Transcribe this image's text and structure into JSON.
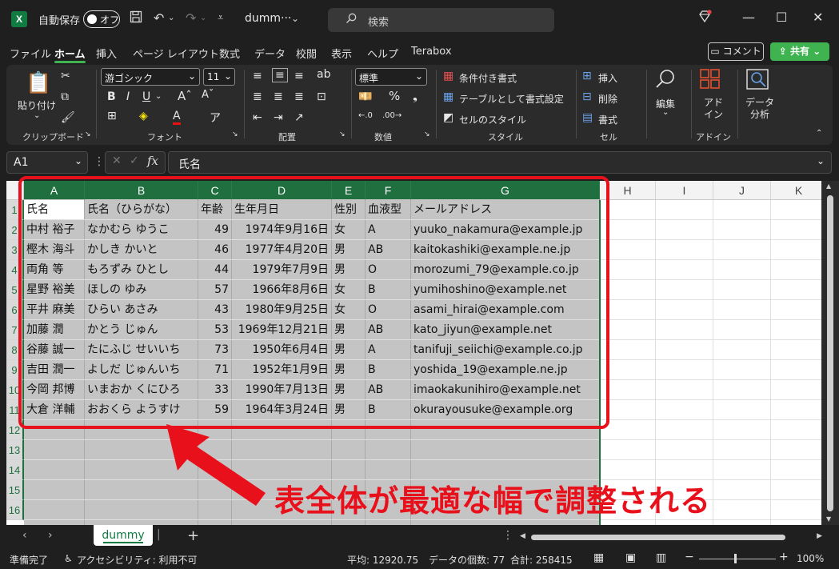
{
  "titlebar": {
    "autosave_label": "自動保存",
    "autosave_state": "オフ",
    "file_name": "dumm···",
    "search_placeholder": "検索"
  },
  "menu": {
    "tabs": [
      "ファイル",
      "ホーム",
      "挿入",
      "ページ レイアウト",
      "数式",
      "データ",
      "校閲",
      "表示",
      "ヘルプ",
      "Terabox"
    ],
    "active_tab": "ホーム",
    "comment_label": "コメント",
    "share_label": "共有"
  },
  "ribbon": {
    "clipboard": {
      "paste_label": "貼り付け",
      "group_label": "クリップボード"
    },
    "font": {
      "font_name": "游ゴシック",
      "font_size": "11",
      "group_label": "フォント"
    },
    "alignment": {
      "group_label": "配置"
    },
    "number": {
      "format": "標準",
      "group_label": "数値"
    },
    "styles": {
      "conditional_label": "条件付き書式",
      "table_label": "テーブルとして書式設定",
      "cell_style_label": "セルのスタイル",
      "group_label": "スタイル"
    },
    "cells": {
      "insert_label": "挿入",
      "delete_label": "削除",
      "format_label": "書式",
      "group_label": "セル"
    },
    "editing": {
      "label": "編集"
    },
    "addins": {
      "label": "アド\nイン",
      "group_label": "アドイン"
    },
    "analysis": {
      "label": "データ\n分析"
    }
  },
  "formula_bar": {
    "name_box": "A1",
    "formula": "氏名"
  },
  "columns": [
    "A",
    "B",
    "C",
    "D",
    "E",
    "F",
    "G",
    "H",
    "I",
    "J",
    "K"
  ],
  "rows": [
    "1",
    "2",
    "3",
    "4",
    "5",
    "6",
    "7",
    "8",
    "9",
    "10",
    "11",
    "12",
    "13",
    "14",
    "15",
    "16"
  ],
  "table": {
    "header": [
      "氏名",
      "氏名（ひらがな）",
      "年齢",
      "生年月日",
      "性別",
      "血液型",
      "メールアドレス"
    ],
    "rows": [
      [
        "中村 裕子",
        "なかむら ゆうこ",
        "49",
        "1974年9月16日",
        "女",
        "A",
        "yuuko_nakamura@example.jp"
      ],
      [
        "樫木 海斗",
        "かしき かいと",
        "46",
        "1977年4月20日",
        "男",
        "AB",
        "kaitokashiki@example.ne.jp"
      ],
      [
        "両角 等",
        "もろずみ ひとし",
        "44",
        "1979年7月9日",
        "男",
        "O",
        "morozumi_79@example.co.jp"
      ],
      [
        "星野 裕美",
        "ほしの ゆみ",
        "57",
        "1966年8月6日",
        "女",
        "B",
        "yumihoshino@example.net"
      ],
      [
        "平井 麻美",
        "ひらい あさみ",
        "43",
        "1980年9月25日",
        "女",
        "O",
        "asami_hirai@example.com"
      ],
      [
        "加藤 潤",
        "かとう じゅん",
        "53",
        "1969年12月21日",
        "男",
        "AB",
        "kato_jiyun@example.net"
      ],
      [
        "谷藤 誠一",
        "たにふじ せいいち",
        "73",
        "1950年6月4日",
        "男",
        "A",
        "tanifuji_seiichi@example.co.jp"
      ],
      [
        "吉田 潤一",
        "よしだ じゅんいち",
        "71",
        "1952年1月9日",
        "男",
        "B",
        "yoshida_19@example.ne.jp"
      ],
      [
        "今岡 邦博",
        "いまおか くにひろ",
        "33",
        "1990年7月13日",
        "男",
        "AB",
        "imaokakunihiro@example.net"
      ],
      [
        "大倉 洋輔",
        "おおくら ようすけ",
        "59",
        "1964年3月24日",
        "男",
        "B",
        "okurayousuke@example.org"
      ]
    ]
  },
  "annotation": {
    "text": "表全体が最適な幅で調整される",
    "color": "#e8101a"
  },
  "sheet": {
    "tab_name": "dummy",
    "add_label": "+"
  },
  "status": {
    "ready": "準備完了",
    "accessibility": "アクセシビリティ: 利用不可",
    "average": "平均: 12920.75",
    "count": "データの個数: 77",
    "sum": "合計: 258415",
    "zoom": "100%"
  },
  "colors": {
    "accent": "#3fb34f",
    "excel_green": "#107c41",
    "selection_header": "#1f6f3f"
  }
}
